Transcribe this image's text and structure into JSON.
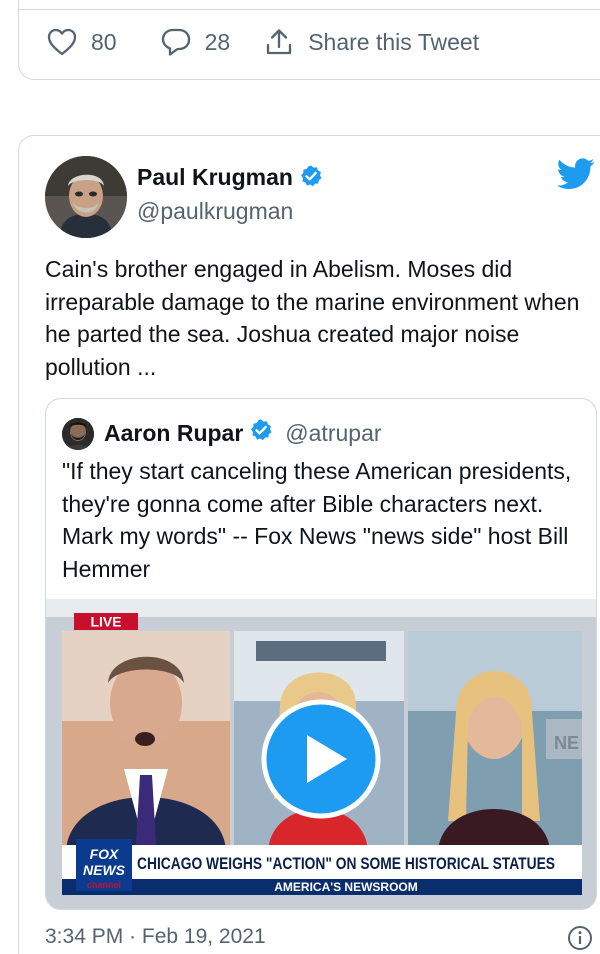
{
  "previous_tweet": {
    "likes": "80",
    "replies": "28",
    "share_label": "Share this Tweet"
  },
  "tweet": {
    "author_name": "Paul Krugman",
    "author_handle": "@paulkrugman",
    "text": "Cain's brother engaged in Abelism. Moses did irreparable damage to the marine environment when he parted the sea. Joshua created major noise pollution ...",
    "timestamp": "3:34 PM · Feb 19, 2021"
  },
  "quoted_tweet": {
    "author_name": "Aaron Rupar",
    "author_handle": "@atrupar",
    "text": "\"If they start canceling these American presidents, they're gonna come after Bible characters next. Mark my words\" -- Fox News \"news side\" host Bill Hemmer",
    "video": {
      "live_label": "LIVE",
      "logo_line1": "FOX",
      "logo_line2": "NEWS",
      "logo_line3": "channel",
      "headline": "CHICAGO WEIGHS \"ACTION\" ON SOME HISTORICAL STATUES",
      "show_name": "AMERICA'S NEWSROOM",
      "watermark": "NE"
    }
  },
  "icons": {
    "like": "heart-icon",
    "reply": "reply-bubble-icon",
    "share": "share-upload-icon",
    "verified": "verified-badge-icon",
    "brand": "twitter-bird-icon",
    "play": "play-icon",
    "info": "info-icon"
  },
  "colors": {
    "twitter_blue": "#1d9bf0",
    "secondary_text": "#536471",
    "border": "#cfd9de",
    "live_red": "#c8102e",
    "chyron_blue": "#0a2d6e"
  }
}
